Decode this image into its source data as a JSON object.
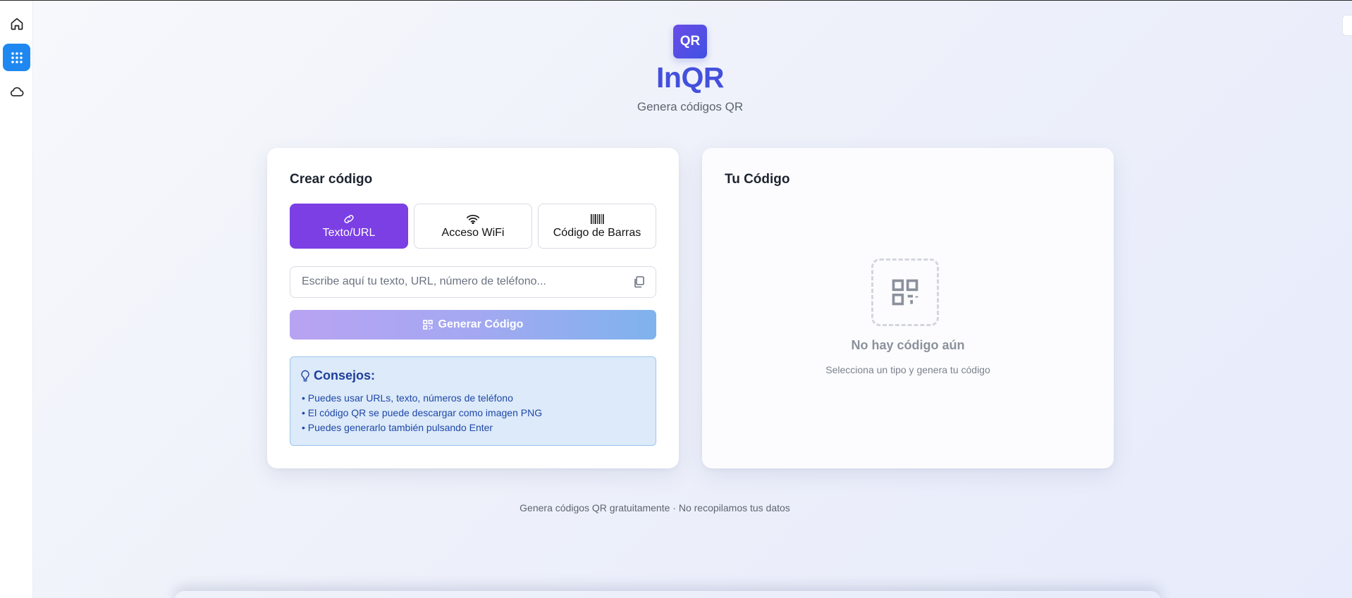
{
  "rail": {
    "home_icon": "home-icon",
    "apps_icon": "grid-icon",
    "cloud_icon": "cloud-icon",
    "active_color": "#1e88f0"
  },
  "header": {
    "logo_text": "QR",
    "title": "InQR",
    "subtitle": "Genera códigos QR"
  },
  "create": {
    "title": "Crear código",
    "tabs": [
      {
        "label": "Texto/URL",
        "icon": "link-icon",
        "active": true
      },
      {
        "label": "Acceso WiFi",
        "icon": "wifi-icon",
        "active": false
      },
      {
        "label": "Código de Barras",
        "icon": "barcode-icon",
        "active": false
      }
    ],
    "input": {
      "value": "",
      "placeholder": "Escribe aquí tu texto, URL, número de teléfono..."
    },
    "generate_label": "Generar Código",
    "tips": {
      "title": "Consejos:",
      "items": [
        "Puedes usar URLs, texto, números de teléfono",
        "El código QR se puede descargar como imagen PNG",
        "Puedes generarlo también pulsando Enter"
      ]
    }
  },
  "result": {
    "title": "Tu Código",
    "empty_title": "No hay código aún",
    "empty_subtitle": "Selecciona un tipo y genera tu código"
  },
  "footer": {
    "text": "Genera códigos QR gratuitamente · No recopilamos tus datos"
  },
  "colors": {
    "accent": "#7b3fe4",
    "brand": "#4450dc",
    "tips_bg": "#dceaf9"
  }
}
